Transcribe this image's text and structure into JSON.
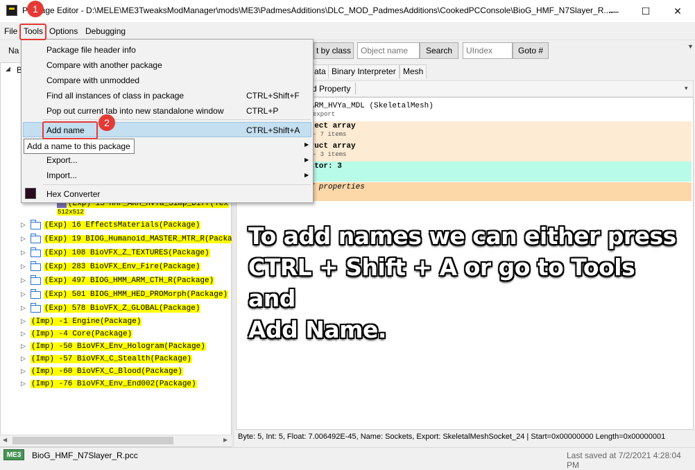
{
  "window": {
    "title": "Package Editor - D:\\MELE\\ME3TweaksModManager\\mods\\ME3\\PadmesAdditions\\DLC_MOD_PadmesAdditions\\CookedPCConsole\\BioG_HMF_N7Slayer_R....",
    "minimize_glyph": "—",
    "maximize_glyph": "☐",
    "close_glyph": "✕"
  },
  "menubar": {
    "items": [
      "File",
      "Tools",
      "Options",
      "Debugging"
    ]
  },
  "toolbar": {
    "left_label": "Na",
    "find_by_class_label": "t by class",
    "object_name_placeholder": "Object name",
    "search_label": "Search",
    "uindex_placeholder": "UIndex",
    "goto_label": "Goto #"
  },
  "tree": {
    "root_arrow": "◢",
    "root_label": "B",
    "partial_row": "(Exp) 15 HMF_ARM_HVYa_Simp_Diff(Tex",
    "partial_sub": "512x512",
    "rows": [
      {
        "label": "(Exp) 16 EffectsMaterials(Package)"
      },
      {
        "label": "(Exp) 19 BIOG_Humanoid_MASTER_MTR_R(Packa"
      },
      {
        "label": "(Exp) 108 BioVFX_Z_TEXTURES(Package)"
      },
      {
        "label": "(Exp) 283 BioVFX_Env_Fire(Package)"
      },
      {
        "label": "(Exp) 497 BIOG_HMM_ARM_CTH_R(Package)"
      },
      {
        "label": "(Exp) 501 BIOG_HMM_HED_PROMorph(Package)"
      },
      {
        "label": "(Exp) 578 BioVFX_Z_GLOBAL(Package)"
      },
      {
        "label": "(Imp) -1 Engine(Package)"
      },
      {
        "label": "(Imp) -4 Core(Package)"
      },
      {
        "label": "(Imp) -50 BioVFX_Env_Hologram(Package)"
      },
      {
        "label": "(Imp) -57 BioVFX_C_Stealth(Package)"
      },
      {
        "label": "(Imp) -60 BioVFX_C_Blood(Package)"
      },
      {
        "label": "(Imp) -76 BioVFX_Env_End002(Package)"
      }
    ]
  },
  "right": {
    "tabs": [
      "ata",
      "Binary Interpreter",
      "Mesh"
    ],
    "prop_toolbar_label": "d Property",
    "prop_rows": [
      {
        "main": "_ARM_HVYa_MDL (SkeletalMesh)",
        "sub": "d export",
        "color": "#ffffff"
      },
      {
        "main": "bject array",
        "sub": "y - 7 items",
        "color": "#fdebd3"
      },
      {
        "main": "truct array",
        "sub": "y - 3 items",
        "color": "#fdebd3"
      },
      {
        "main": "actor: 3",
        "sub": "y",
        "color": "#b7fbe8"
      },
      {
        "main": "of properties",
        "sub": "",
        "color": "#fcd7a8"
      }
    ],
    "annotation_lines": [
      "To add names we can either press",
      "CTRL + Shift + A or go to Tools and",
      "Add Name."
    ],
    "status": "Byte: 5, Int: 5, Float: 7.006492E-45, Name: Sockets, Export: SkeletalMeshSocket_24 | Start=0x00000000 Length=0x00000001"
  },
  "statusbar": {
    "game": "ME3",
    "filename": "BioG_HMF_N7Slayer_R.pcc",
    "last_saved": "Last saved at 7/2/2021 4:28:04 PM"
  },
  "tools_menu": {
    "items": [
      {
        "label": "Package file header info",
        "shortcut": ""
      },
      {
        "label": "Compare with another package",
        "shortcut": ""
      },
      {
        "label": "Compare with unmodded",
        "shortcut": ""
      },
      {
        "label": "Find all instances of class in package",
        "shortcut": "CTRL+Shift+F"
      },
      {
        "label": "Pop out current tab into new standalone window",
        "shortcut": "CTRL+P"
      },
      {
        "label": "Add name",
        "shortcut": "CTRL+Shift+A"
      },
      {
        "label": "Export...",
        "shortcut": ""
      },
      {
        "label": "Import...",
        "shortcut": ""
      },
      {
        "label": "Hex Converter",
        "shortcut": ""
      }
    ],
    "submenu_arrow": "▶",
    "tooltip": "Add a name to this package"
  },
  "callouts": [
    "1",
    "2"
  ],
  "colors": {
    "highlight": "#ffff00",
    "callout": "#e53935",
    "menu_hover": "#c4dff0",
    "game_badge": "#4a9457"
  }
}
